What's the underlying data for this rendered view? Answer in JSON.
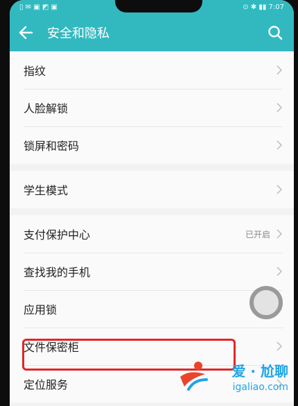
{
  "status_bar": {
    "left": "▯ ✉ ▣ ◩ ▣",
    "right": "⊙ ✱ ▮▮ 7:07"
  },
  "header": {
    "title": "安全和隐私"
  },
  "groups": [
    [
      {
        "label": "指纹"
      },
      {
        "label": "人脸解锁"
      },
      {
        "label": "锁屏和密码"
      }
    ],
    [
      {
        "label": "学生模式"
      }
    ],
    [
      {
        "label": "支付保护中心",
        "status": "已开启"
      },
      {
        "label": "查找我的手机"
      },
      {
        "label": "应用锁"
      },
      {
        "label": "文件保密柜"
      },
      {
        "label": "定位服务"
      }
    ]
  ],
  "watermark": {
    "title": "爱 · 尬聊",
    "subtitle": "igaliao.com"
  },
  "colors": {
    "accent": "#32b9c0",
    "highlight": "#e32526",
    "watermark": "#1fa4e6"
  }
}
